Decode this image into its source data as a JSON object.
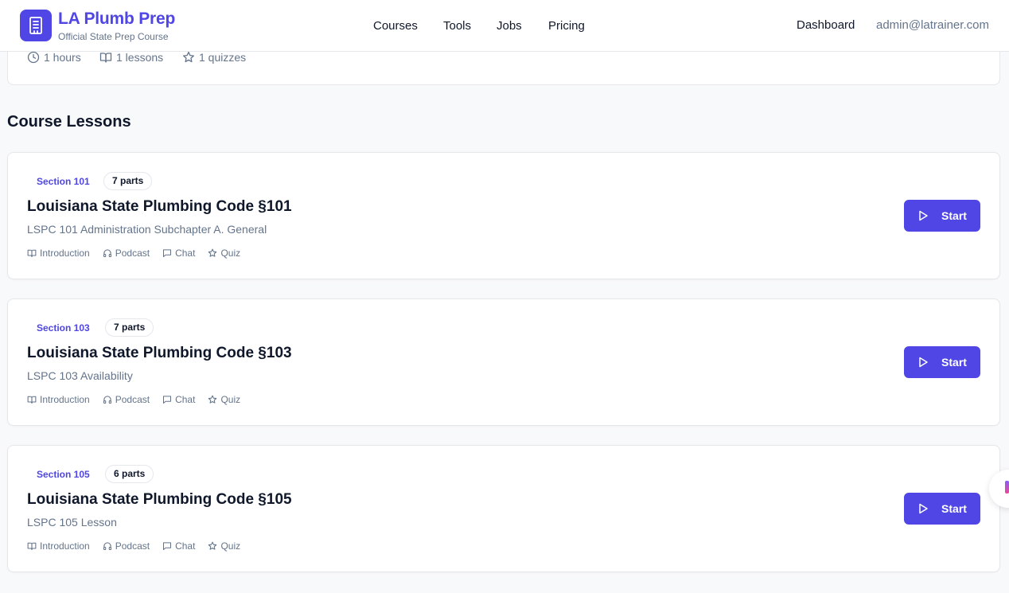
{
  "header": {
    "brand_title": "LA Plumb Prep",
    "brand_subtitle": "Official State Prep Course",
    "nav": [
      "Courses",
      "Tools",
      "Jobs",
      "Pricing"
    ],
    "dashboard": "Dashboard",
    "email": "admin@latrainer.com"
  },
  "course_stats": {
    "hours": "1 hours",
    "lessons": "1 lessons",
    "quizzes": "1 quizzes"
  },
  "section_heading": "Course Lessons",
  "lessons": [
    {
      "section": "Section 101",
      "parts": "7 parts",
      "title": "Louisiana State Plumbing Code §101",
      "description": "LSPC 101 Administration Subchapter A. General",
      "features": [
        "Introduction",
        "Podcast",
        "Chat",
        "Quiz"
      ],
      "button": "Start"
    },
    {
      "section": "Section 103",
      "parts": "7 parts",
      "title": "Louisiana State Plumbing Code §103",
      "description": "LSPC 103 Availability",
      "features": [
        "Introduction",
        "Podcast",
        "Chat",
        "Quiz"
      ],
      "button": "Start"
    },
    {
      "section": "Section 105",
      "parts": "6 parts",
      "title": "Louisiana State Plumbing Code §105",
      "description": "LSPC 105 Lesson",
      "features": [
        "Introduction",
        "Podcast",
        "Chat",
        "Quiz"
      ],
      "button": "Start"
    }
  ],
  "colors": {
    "accent": "#4f46e5",
    "muted_text": "#64748b",
    "border": "#e5e7eb"
  },
  "icons": {
    "logo": "building-icon",
    "stats": [
      "clock-icon",
      "book-open-icon",
      "star-icon"
    ],
    "features": [
      "book-open-icon",
      "headphones-icon",
      "message-square-icon",
      "star-icon"
    ],
    "button": "play-icon"
  }
}
